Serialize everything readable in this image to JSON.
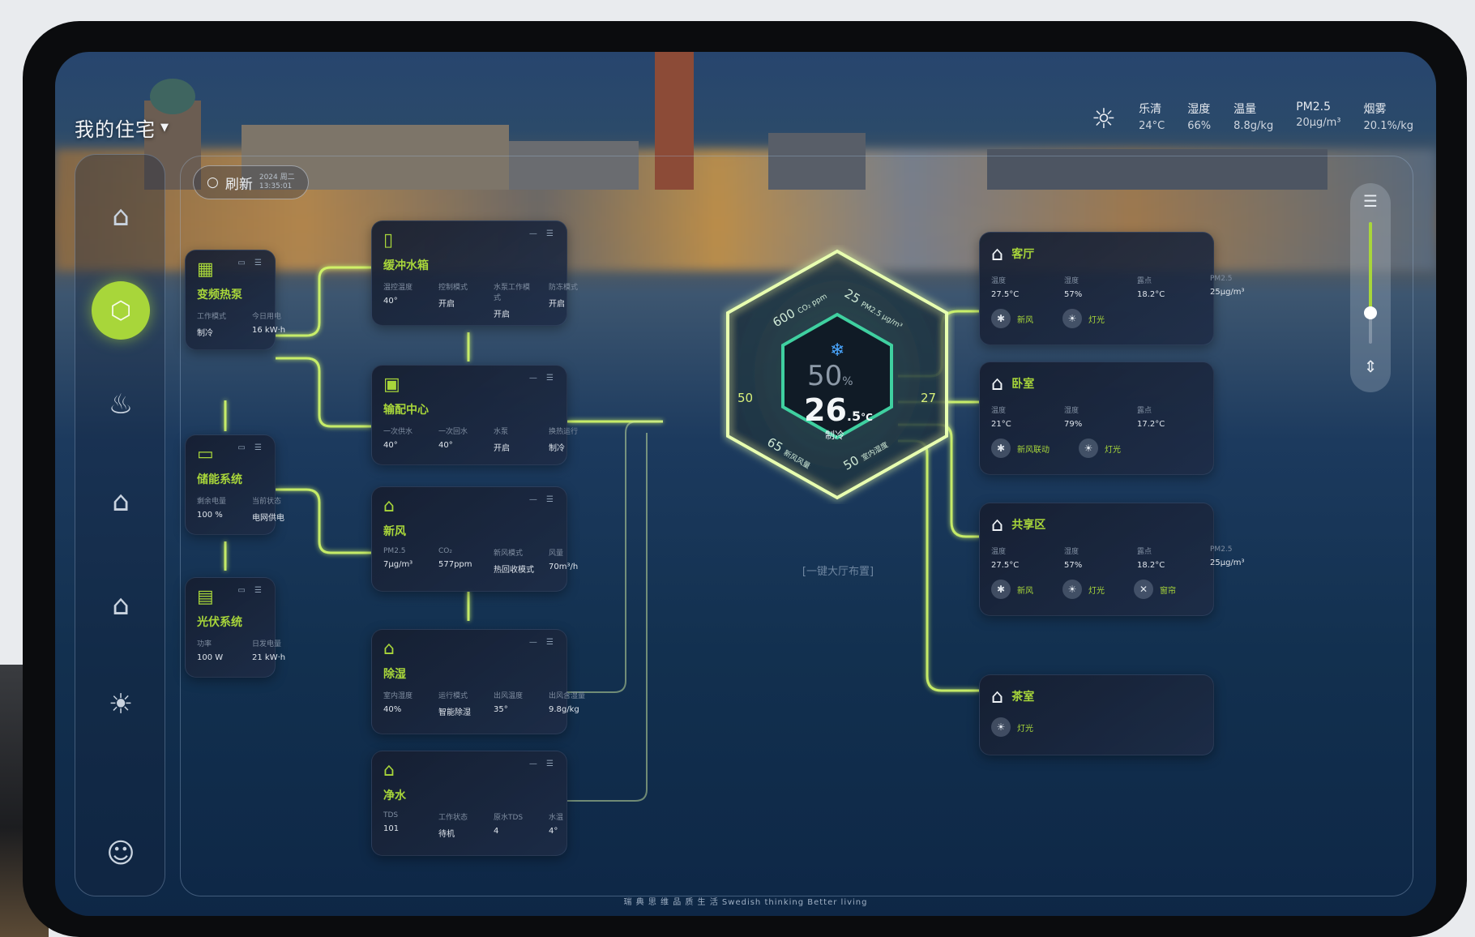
{
  "header": {
    "title": "我的住宅",
    "refresh_label": "刷新",
    "refresh_time": "2024 周二\n13:35:01"
  },
  "weather": [
    {
      "label": "乐清",
      "value": "24°C"
    },
    {
      "label": "湿度",
      "value": "66%"
    },
    {
      "label": "温量",
      "value": "8.8g/kg"
    },
    {
      "label": "PM2.5",
      "value": "20μg/m³"
    },
    {
      "label": "烟雾",
      "value": "20.1%/kg"
    }
  ],
  "devices": {
    "heatpump": {
      "name": "变频热泵",
      "k1": "工作模式",
      "v1": "制冷",
      "k2": "今日用电",
      "v2": "16 kW·h"
    },
    "storage": {
      "name": "储能系统",
      "k1": "剩余电量",
      "v1": "100 %",
      "k2": "当前状态",
      "v2": "电网供电"
    },
    "pv": {
      "name": "光伏系统",
      "k1": "功率",
      "v1": "100 W",
      "k2": "日发电量",
      "v2": "21 kW·h"
    },
    "buffer": {
      "name": "缓冲水箱",
      "k1": "温控温度",
      "v1": "40°",
      "k2": "控制模式",
      "v2": "开启",
      "k3": "水泵工作模式",
      "v3": "开启",
      "k4": "防冻模式",
      "v4": "开启"
    },
    "distribution": {
      "name": "输配中心",
      "k1": "一次供水",
      "v1": "40°",
      "k2": "一次回水",
      "v2": "40°",
      "k3": "水泵",
      "v3": "开启",
      "k4": "换热运行",
      "v4": "制冷"
    },
    "freshair": {
      "name": "新风",
      "k1": "PM2.5",
      "v1": "7μg/m³",
      "k2": "CO₂",
      "v2": "577ppm",
      "k3": "新风模式",
      "v3": "热回收模式",
      "k4": "风量",
      "v4": "70m³/h"
    },
    "humid": {
      "name": "除湿",
      "k1": "室内湿度",
      "v1": "40%",
      "k2": "运行模式",
      "v2": "智能除湿",
      "k3": "出风温度",
      "v3": "35°",
      "k4": "出风含湿量",
      "v4": "9.8g/kg"
    },
    "water": {
      "name": "净水",
      "k1": "TDS",
      "v1": "101",
      "k2": "工作状态",
      "v2": "待机",
      "k3": "原水TDS",
      "v3": "4",
      "k4": "水温",
      "v4": "4°"
    }
  },
  "hex": {
    "humidity": "50",
    "humidity_unit": "%",
    "temp": "26",
    "temp_dec": ".5",
    "temp_unit": "°C",
    "mode": "制冷",
    "left_val": "50",
    "right_val": "27",
    "tl": "600",
    "tl_sub": "CO₂ ppm",
    "tr": "25",
    "tr_sub": "PM2.5 μg/m³",
    "bl": "65",
    "bl_sub": "新风风量",
    "br": "50",
    "br_sub": "室内湿度",
    "caption": "[一键大厅布置]"
  },
  "rooms": [
    {
      "name": "客厅",
      "k": [
        "温度",
        "湿度",
        "露点",
        "PM2.5"
      ],
      "v": [
        "27.5°C",
        "57%",
        "18.2°C",
        "25μg/m³"
      ],
      "acts": [
        "新风",
        "灯光"
      ]
    },
    {
      "name": "卧室",
      "k": [
        "温度",
        "湿度",
        "露点"
      ],
      "v": [
        "21°C",
        "79%",
        "17.2°C"
      ],
      "acts": [
        "新风联动",
        "灯光"
      ]
    },
    {
      "name": "共享区",
      "k": [
        "温度",
        "湿度",
        "露点",
        "PM2.5"
      ],
      "v": [
        "27.5°C",
        "57%",
        "18.2°C",
        "25μg/m³"
      ],
      "acts": [
        "新风",
        "灯光",
        "窗帘"
      ]
    },
    {
      "name": "茶室",
      "k": [],
      "v": [],
      "acts": [
        "灯光"
      ]
    }
  ],
  "footer": "瑞 典 思 维   品 质 生 活   Swedish thinking  Better living",
  "colors": {
    "accent": "#a8d63a",
    "panel": "#16203a",
    "background": "#12304f"
  }
}
